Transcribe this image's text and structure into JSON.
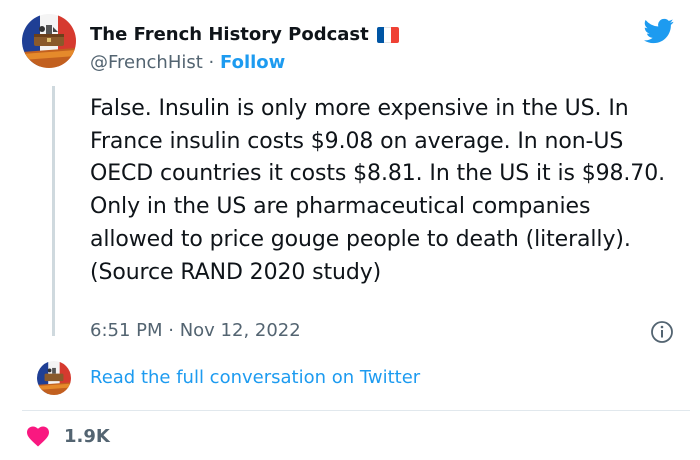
{
  "author": {
    "name": "The French History Podcast",
    "handle": "@FrenchHist",
    "separator": "·",
    "follow_label": "Follow",
    "flag_colors": [
      "#0055a4",
      "#ffffff",
      "#ef4135"
    ],
    "avatar_icon": "french-flag-crest-avatar"
  },
  "brand": {
    "logo": "twitter-bird-icon",
    "color": "#1d9bf0"
  },
  "tweet": {
    "text": "False. Insulin is only more expensive in the US. In France insulin costs $9.08 on average. In non-US OECD countries it costs $8.81. In the US it is $98.70. Only in the US are pharmaceutical companies allowed to price gouge people to death (literally). (Source RAND 2020 study)",
    "timestamp": "6:51 PM · Nov 12, 2022",
    "info_icon": "info-circle-icon"
  },
  "conversation": {
    "link_label": "Read the full conversation on Twitter"
  },
  "engagement": {
    "like_icon": "heart-icon",
    "like_color": "#f91880",
    "likes": "1.9K"
  }
}
